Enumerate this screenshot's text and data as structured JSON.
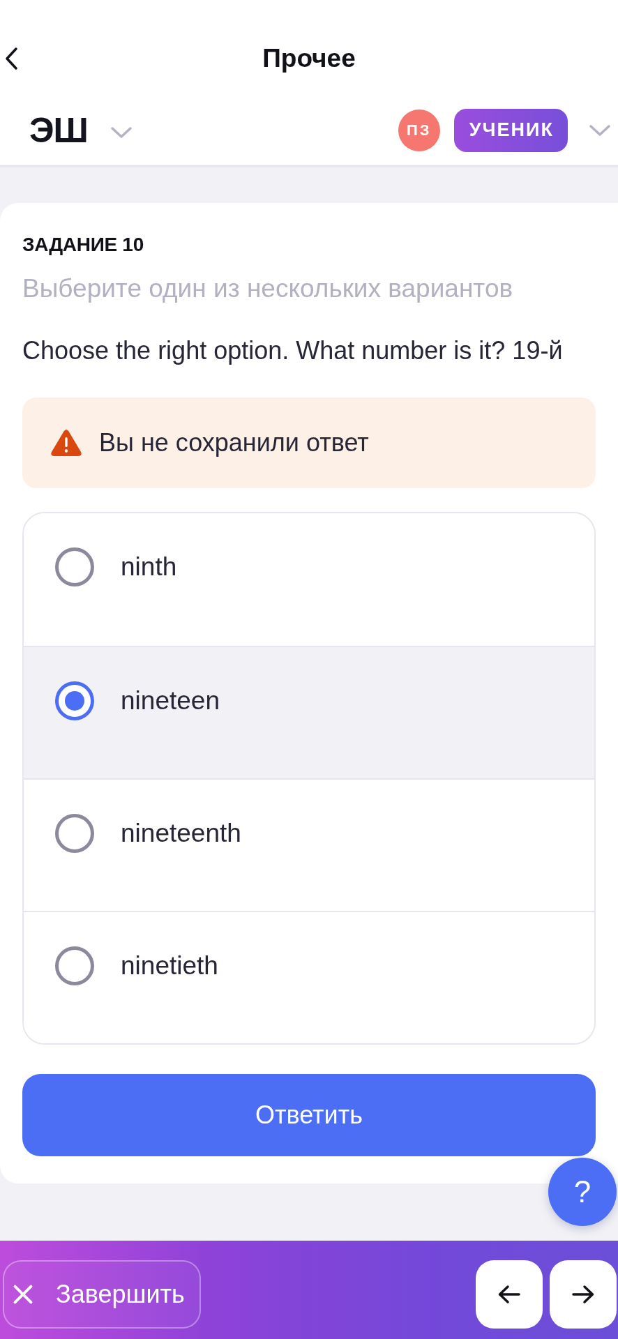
{
  "nav": {
    "title": "Прочее"
  },
  "header": {
    "logo": "ЭШ",
    "avatar_initials": "ПЗ",
    "role": "УЧЕНИК"
  },
  "task": {
    "label": "ЗАДАНИЕ 10",
    "instruction": "Выберите один из нескольких вариантов",
    "question": "Choose the right option. What number is it? 19-й",
    "warning": "Вы не сохранили ответ",
    "options": [
      {
        "label": "ninth",
        "selected": false
      },
      {
        "label": "nineteen",
        "selected": true
      },
      {
        "label": "nineteenth",
        "selected": false
      },
      {
        "label": "ninetieth",
        "selected": false
      }
    ],
    "submit": "Ответить"
  },
  "help_button": "?",
  "bottom_bar": {
    "finish": "Завершить"
  }
}
